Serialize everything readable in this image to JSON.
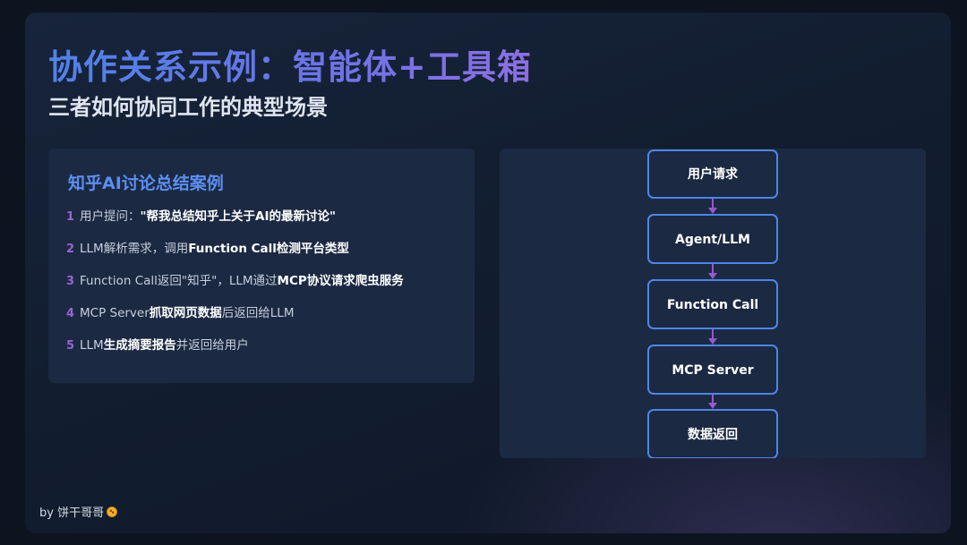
{
  "slide": {
    "title": "协作关系示例：智能体+工具箱",
    "subtitle": "三者如何协同工作的典型场景"
  },
  "case": {
    "title": "知乎AI讨论总结案例",
    "steps": [
      {
        "num": "1",
        "pre": "用户提问：",
        "bold": "\"帮我总结知乎上关于AI的最新讨论\"",
        "post": ""
      },
      {
        "num": "2",
        "pre": "LLM解析需求，调用",
        "bold": "Function Call检测平台类型",
        "post": ""
      },
      {
        "num": "3",
        "pre": "Function Call返回\"知乎\"，LLM通过",
        "bold": "MCP协议请求爬虫服务",
        "post": ""
      },
      {
        "num": "4",
        "pre": "MCP Server",
        "bold": "抓取网页数据",
        "post": "后返回给LLM"
      },
      {
        "num": "5",
        "pre": "LLM",
        "bold": "生成摘要报告",
        "post": "并返回给用户"
      }
    ]
  },
  "flow": {
    "nodes": [
      "用户请求",
      "Agent/LLM",
      "Function Call",
      "MCP Server",
      "数据返回"
    ],
    "colors": {
      "node_border": "#4d86ea",
      "arrow": "#9a57d0"
    }
  },
  "footer": {
    "author": "by 饼干哥哥",
    "emoji_icon": "cookie-icon"
  }
}
